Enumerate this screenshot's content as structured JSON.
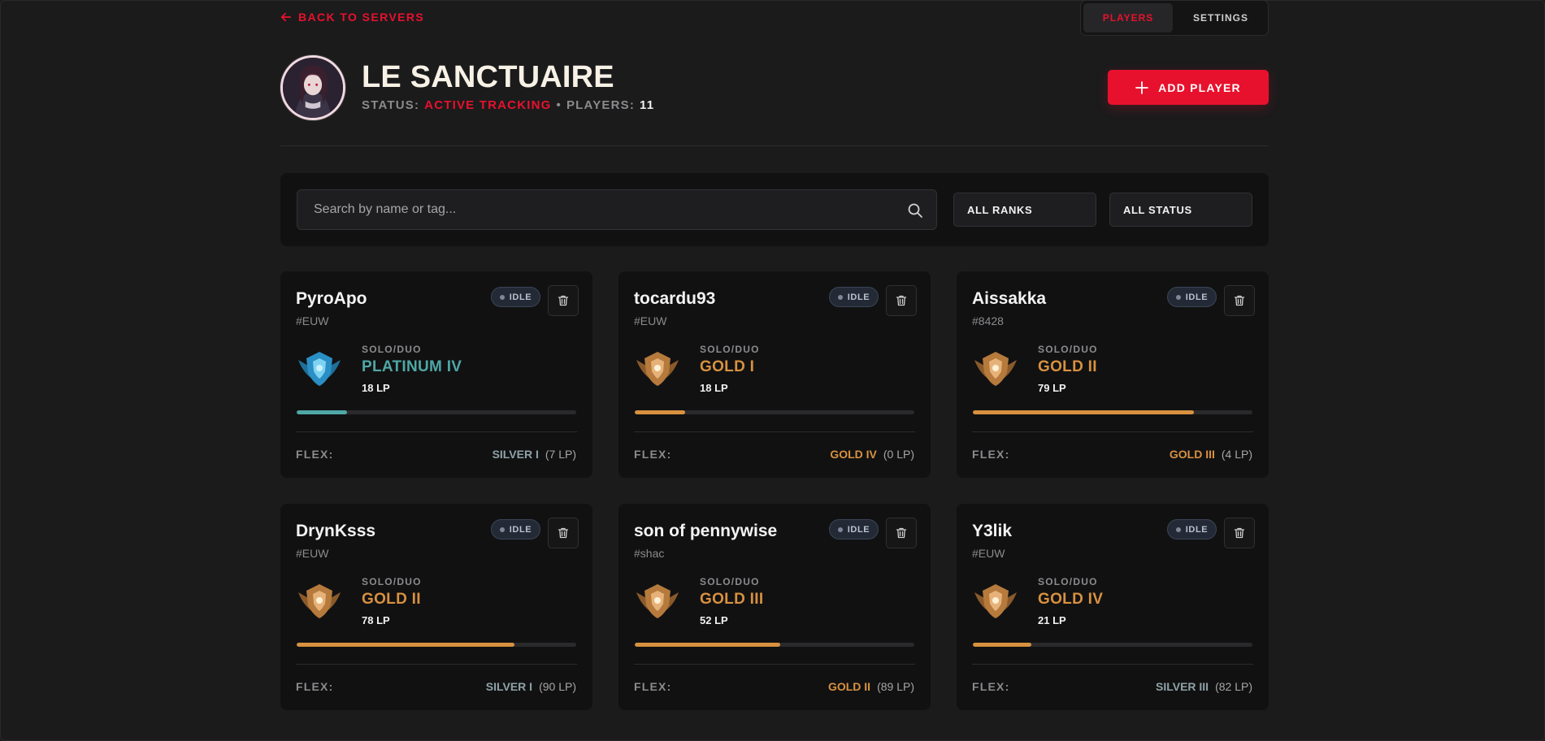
{
  "nav": {
    "back_label": "BACK TO SERVERS"
  },
  "tabs": [
    {
      "label": "PLAYERS",
      "active": true
    },
    {
      "label": "SETTINGS",
      "active": false
    }
  ],
  "server": {
    "name": "LE SANCTUAIRE",
    "status_label": "STATUS:",
    "status_value": "ACTIVE TRACKING",
    "separator": "•",
    "players_label": "PLAYERS:",
    "players_count": "11"
  },
  "actions": {
    "add_player_label": "ADD PLAYER"
  },
  "filters": {
    "search_placeholder": "Search by name or tag...",
    "search_value": "",
    "ranks_label": "ALL RANKS",
    "status_label": "ALL STATUS"
  },
  "colors": {
    "accent": "#e8112d",
    "platinum": "#4fa7a6",
    "gold": "#d8913f",
    "silver": "#8fa2a8"
  },
  "players": [
    {
      "name": "PyroApo",
      "tag": "#EUW",
      "status": "IDLE",
      "queue": "SOLO/DUO",
      "rank": "PLATINUM IV",
      "tier": "platinum",
      "lp": "18 LP",
      "progress": 0.18,
      "flex_label": "FLEX:",
      "flex_rank": "SILVER I",
      "flex_tier": "silver",
      "flex_lp": "(7 LP)"
    },
    {
      "name": "tocardu93",
      "tag": "#EUW",
      "status": "IDLE",
      "queue": "SOLO/DUO",
      "rank": "GOLD I",
      "tier": "gold",
      "lp": "18 LP",
      "progress": 0.18,
      "flex_label": "FLEX:",
      "flex_rank": "GOLD IV",
      "flex_tier": "gold",
      "flex_lp": "(0 LP)"
    },
    {
      "name": "Aissakka",
      "tag": "#8428",
      "status": "IDLE",
      "queue": "SOLO/DUO",
      "rank": "GOLD II",
      "tier": "gold",
      "lp": "79 LP",
      "progress": 0.79,
      "flex_label": "FLEX:",
      "flex_rank": "GOLD III",
      "flex_tier": "gold",
      "flex_lp": "(4 LP)"
    },
    {
      "name": "DrynKsss",
      "tag": "#EUW",
      "status": "IDLE",
      "queue": "SOLO/DUO",
      "rank": "GOLD II",
      "tier": "gold",
      "lp": "78 LP",
      "progress": 0.78,
      "flex_label": "FLEX:",
      "flex_rank": "SILVER I",
      "flex_tier": "silver",
      "flex_lp": "(90 LP)"
    },
    {
      "name": "son of pennywise",
      "tag": "#shac",
      "status": "IDLE",
      "queue": "SOLO/DUO",
      "rank": "GOLD III",
      "tier": "gold",
      "lp": "52 LP",
      "progress": 0.52,
      "flex_label": "FLEX:",
      "flex_rank": "GOLD II",
      "flex_tier": "gold",
      "flex_lp": "(89 LP)"
    },
    {
      "name": "Y3lik",
      "tag": "#EUW",
      "status": "IDLE",
      "queue": "SOLO/DUO",
      "rank": "GOLD IV",
      "tier": "gold",
      "lp": "21 LP",
      "progress": 0.21,
      "flex_label": "FLEX:",
      "flex_rank": "SILVER III",
      "flex_tier": "silver",
      "flex_lp": "(82 LP)"
    }
  ]
}
